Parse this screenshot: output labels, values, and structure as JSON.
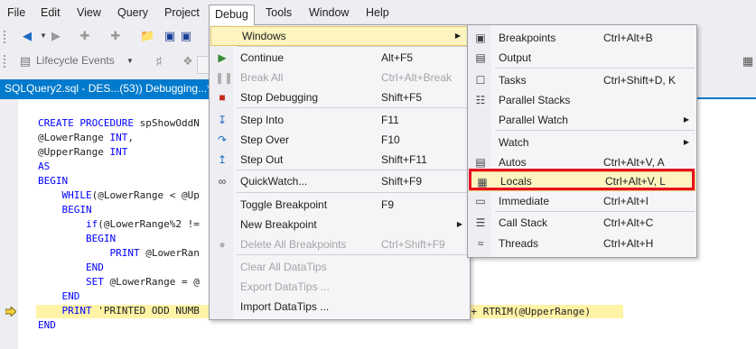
{
  "menubar": {
    "items": [
      "File",
      "Edit",
      "View",
      "Query",
      "Project",
      "Debug",
      "Tools",
      "Window",
      "Help"
    ],
    "open_item": "Debug"
  },
  "toolbar2": {
    "lifecycle_label": "Lifecycle Events"
  },
  "document_tab": {
    "title": "SQLQuery2.sql - DES...(53)) Debugging...*"
  },
  "code_lines": [
    "CREATE PROCEDURE spShowOddN",
    "@LowerRange INT,",
    "@UpperRange INT",
    "AS",
    "BEGIN",
    "    WHILE(@LowerRange < @Up",
    "    BEGIN",
    "        if(@LowerRange%2 !=",
    "        BEGIN",
    "            PRINT @LowerRan",
    "        END",
    "        SET @LowerRange = @",
    "    END",
    "    PRINT 'PRINTED ODD NUMB",
    "END"
  ],
  "code_tail": "d ' + RTRIM(@UpperRange)",
  "debug_menu": {
    "items": [
      {
        "label": "Windows",
        "shortcut": "",
        "submenu": true,
        "icon": "",
        "disabled": false,
        "highlighted": true
      },
      {
        "label": "Continue",
        "shortcut": "Alt+F5",
        "icon": "play-icon",
        "disabled": false
      },
      {
        "label": "Break All",
        "shortcut": "Ctrl+Alt+Break",
        "icon": "pause-icon",
        "disabled": true
      },
      {
        "label": "Stop Debugging",
        "shortcut": "Shift+F5",
        "icon": "stop-icon",
        "disabled": false
      },
      {
        "label": "Step Into",
        "shortcut": "F11",
        "icon": "step-into-icon",
        "disabled": false
      },
      {
        "label": "Step Over",
        "shortcut": "F10",
        "icon": "step-over-icon",
        "disabled": false
      },
      {
        "label": "Step Out",
        "shortcut": "Shift+F11",
        "icon": "step-out-icon",
        "disabled": false
      },
      {
        "label": "QuickWatch...",
        "shortcut": "Shift+F9",
        "icon": "glasses-icon",
        "disabled": false
      },
      {
        "label": "Toggle Breakpoint",
        "shortcut": "F9",
        "icon": "",
        "disabled": false
      },
      {
        "label": "New Breakpoint",
        "shortcut": "",
        "submenu": true,
        "icon": "",
        "disabled": false
      },
      {
        "label": "Delete All Breakpoints",
        "shortcut": "Ctrl+Shift+F9",
        "icon": "delete-breakpoints-icon",
        "disabled": true
      },
      {
        "label": "Clear All DataTips",
        "shortcut": "",
        "icon": "",
        "disabled": true
      },
      {
        "label": "Export DataTips ...",
        "shortcut": "",
        "icon": "",
        "disabled": true
      },
      {
        "label": "Import DataTips ...",
        "shortcut": "",
        "icon": "",
        "disabled": false
      }
    ]
  },
  "windows_menu": {
    "items": [
      {
        "label": "Breakpoints",
        "shortcut": "Ctrl+Alt+B",
        "icon": "breakpoints-window-icon"
      },
      {
        "label": "Output",
        "shortcut": "",
        "icon": "output-icon"
      },
      {
        "label": "Tasks",
        "shortcut": "Ctrl+Shift+D, K",
        "icon": "tasks-icon"
      },
      {
        "label": "Parallel Stacks",
        "shortcut": "",
        "icon": "parallel-stacks-icon"
      },
      {
        "label": "Parallel Watch",
        "shortcut": "",
        "submenu": true,
        "icon": ""
      },
      {
        "label": "Watch",
        "shortcut": "",
        "submenu": true,
        "icon": ""
      },
      {
        "label": "Autos",
        "shortcut": "Ctrl+Alt+V, A",
        "icon": "autos-icon"
      },
      {
        "label": "Locals",
        "shortcut": "Ctrl+Alt+V, L",
        "icon": "locals-icon",
        "highlighted": true
      },
      {
        "label": "Immediate",
        "shortcut": "Ctrl+Alt+I",
        "icon": "immediate-icon"
      },
      {
        "label": "Call Stack",
        "shortcut": "Ctrl+Alt+C",
        "icon": "call-stack-icon"
      },
      {
        "label": "Threads",
        "shortcut": "Ctrl+Alt+H",
        "icon": "threads-icon"
      }
    ]
  },
  "colors": {
    "accent": "#007acc",
    "highlight_box": "#e81123",
    "current_line": "#fff3a6",
    "menu_hover": "#fdf4bf"
  }
}
